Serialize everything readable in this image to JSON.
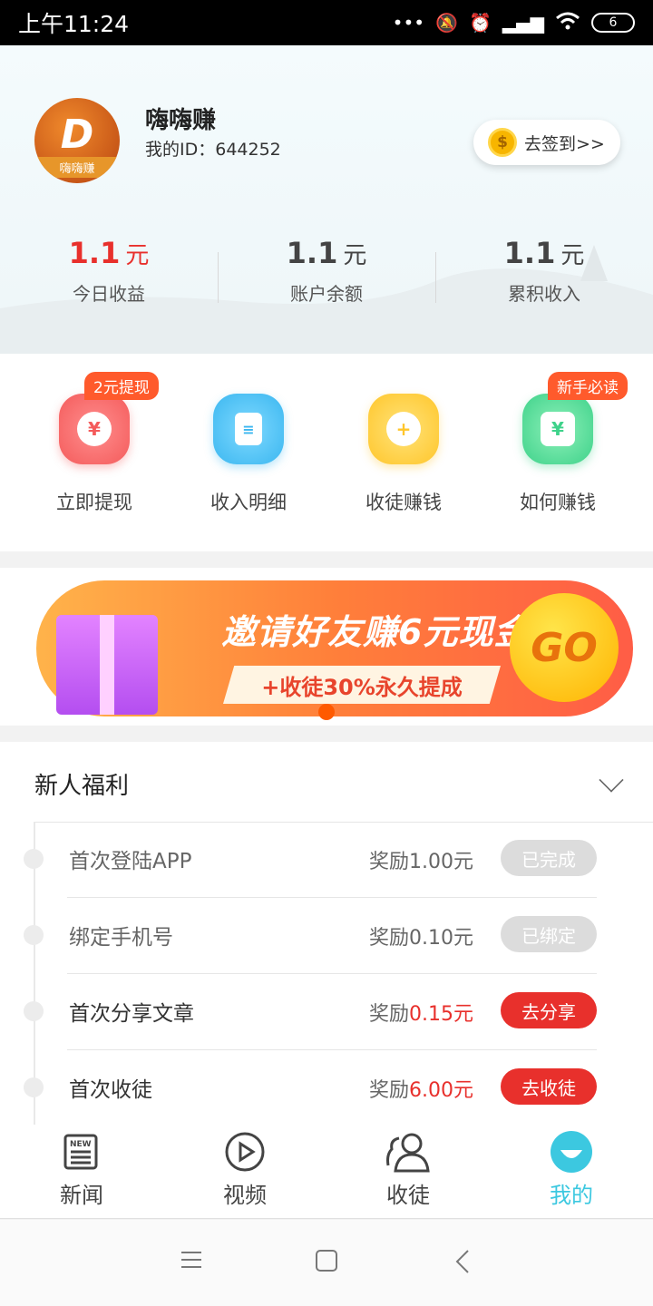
{
  "status_bar": {
    "time": "上午11:24",
    "battery": "6"
  },
  "profile": {
    "app_name": "嗨嗨赚",
    "logo_text": "嗨嗨赚",
    "user_id": "我的ID：644252",
    "checkin_label": "去签到>>",
    "coin_symbol": "$"
  },
  "stats": [
    {
      "value": "1.1",
      "unit": "元",
      "label": "今日收益",
      "color": "#e8302c"
    },
    {
      "value": "1.1",
      "unit": "元",
      "label": "账户余额"
    },
    {
      "value": "1.1",
      "unit": "元",
      "label": "累积收入"
    }
  ],
  "quick_actions": [
    {
      "label": "立即提现",
      "icon": "yen-icon",
      "badge": "2元提现"
    },
    {
      "label": "收入明细",
      "icon": "document-icon"
    },
    {
      "label": "收徒赚钱",
      "icon": "add-user-icon"
    },
    {
      "label": "如何赚钱",
      "icon": "wallet-icon",
      "badge": "新手必读"
    }
  ],
  "banner": {
    "title": "邀请好友赚6元现金",
    "subtitle": "+收徒30%永久提成",
    "go_label": "GO"
  },
  "benefits": {
    "title": "新人福利",
    "items": [
      {
        "name": "首次登陆APP",
        "reward_prefix": "奖励",
        "reward_amount": "1.00元",
        "action": "已完成",
        "done": true
      },
      {
        "name": "绑定手机号",
        "reward_prefix": "奖励",
        "reward_amount": "0.10元",
        "action": "已绑定",
        "done": true
      },
      {
        "name": "首次分享文章",
        "reward_prefix": "奖励",
        "reward_amount": "0.15元",
        "action": "去分享",
        "done": false
      },
      {
        "name": "首次收徒",
        "reward_prefix": "奖励",
        "reward_amount": "6.00元",
        "action": "去收徒",
        "done": false
      }
    ]
  },
  "tabs": [
    {
      "label": "新闻",
      "icon": "news-icon"
    },
    {
      "label": "视频",
      "icon": "play-icon"
    },
    {
      "label": "收徒",
      "icon": "people-icon"
    },
    {
      "label": "我的",
      "icon": "profile-icon",
      "active": true
    }
  ],
  "colors": {
    "accent": "#3cc8e0",
    "red": "#e8302c",
    "orange": "#ff5a2c"
  }
}
